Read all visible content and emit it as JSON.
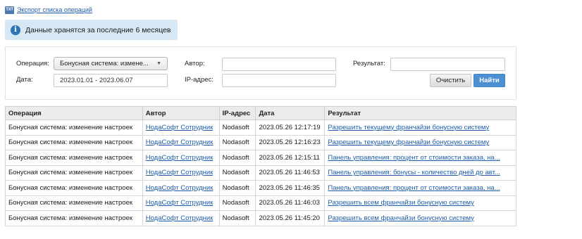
{
  "export": {
    "icon": "txt-file-icon",
    "icon_text": "TXT",
    "label": "Экспорт списка операций"
  },
  "info": {
    "icon": "info-icon",
    "icon_text": "i",
    "message": "Данные хранятся за последние 6 месяцев"
  },
  "filter": {
    "operation_label": "Операция:",
    "operation_value": "Бонусная система: измене...",
    "date_label": "Дата:",
    "date_value": "2023.01.01 - 2023.06.07",
    "author_label": "Автор:",
    "author_value": "",
    "ip_label": "IP-адрес:",
    "ip_value": "",
    "result_label": "Результат:",
    "result_value": "",
    "clear_button": "Очистить",
    "find_button": "Найти"
  },
  "table": {
    "headers": [
      "Операция",
      "Автор",
      "IP-адрес",
      "Дата",
      "Результат"
    ],
    "rows": [
      {
        "operation": "Бонусная система: изменение настроек",
        "author": "НодаСофт Сотрудник",
        "ip": "Nodasoft",
        "date": "2023.05.26 12:17:19",
        "result": "Разрешить текущему франчайзи бонусную систему"
      },
      {
        "operation": "Бонусная система: изменение настроек",
        "author": "НодаСофт Сотрудник",
        "ip": "Nodasoft",
        "date": "2023.05.26 12:16:23",
        "result": "Разрешить текущему франчайзи бонусную систему"
      },
      {
        "operation": "Бонусная система: изменение настроек",
        "author": "НодаСофт Сотрудник",
        "ip": "Nodasoft",
        "date": "2023.05.26 12:15:11",
        "result": "Панель управления: процент от стоимости заказа, на..."
      },
      {
        "operation": "Бонусная система: изменение настроек",
        "author": "НодаСофт Сотрудник",
        "ip": "Nodasoft",
        "date": "2023.05.26 11:46:53",
        "result": "Панель управления: бонусы - количество дней до авт..."
      },
      {
        "operation": "Бонусная система: изменение настроек",
        "author": "НодаСофт Сотрудник",
        "ip": "Nodasoft",
        "date": "2023.05.26 11:46:35",
        "result": "Панель управления: процент от стоимости заказа, на..."
      },
      {
        "operation": "Бонусная система: изменение настроек",
        "author": "НодаСофт Сотрудник",
        "ip": "Nodasoft",
        "date": "2023.05.26 11:46:03",
        "result": "Разрешить всем франчайзи бонусную систему"
      },
      {
        "operation": "Бонусная система: изменение настроек",
        "author": "НодаСофт Сотрудник",
        "ip": "Nodasoft",
        "date": "2023.05.26 11:45:20",
        "result": "Разрешить всем франчайзи бонусную систему"
      }
    ]
  }
}
